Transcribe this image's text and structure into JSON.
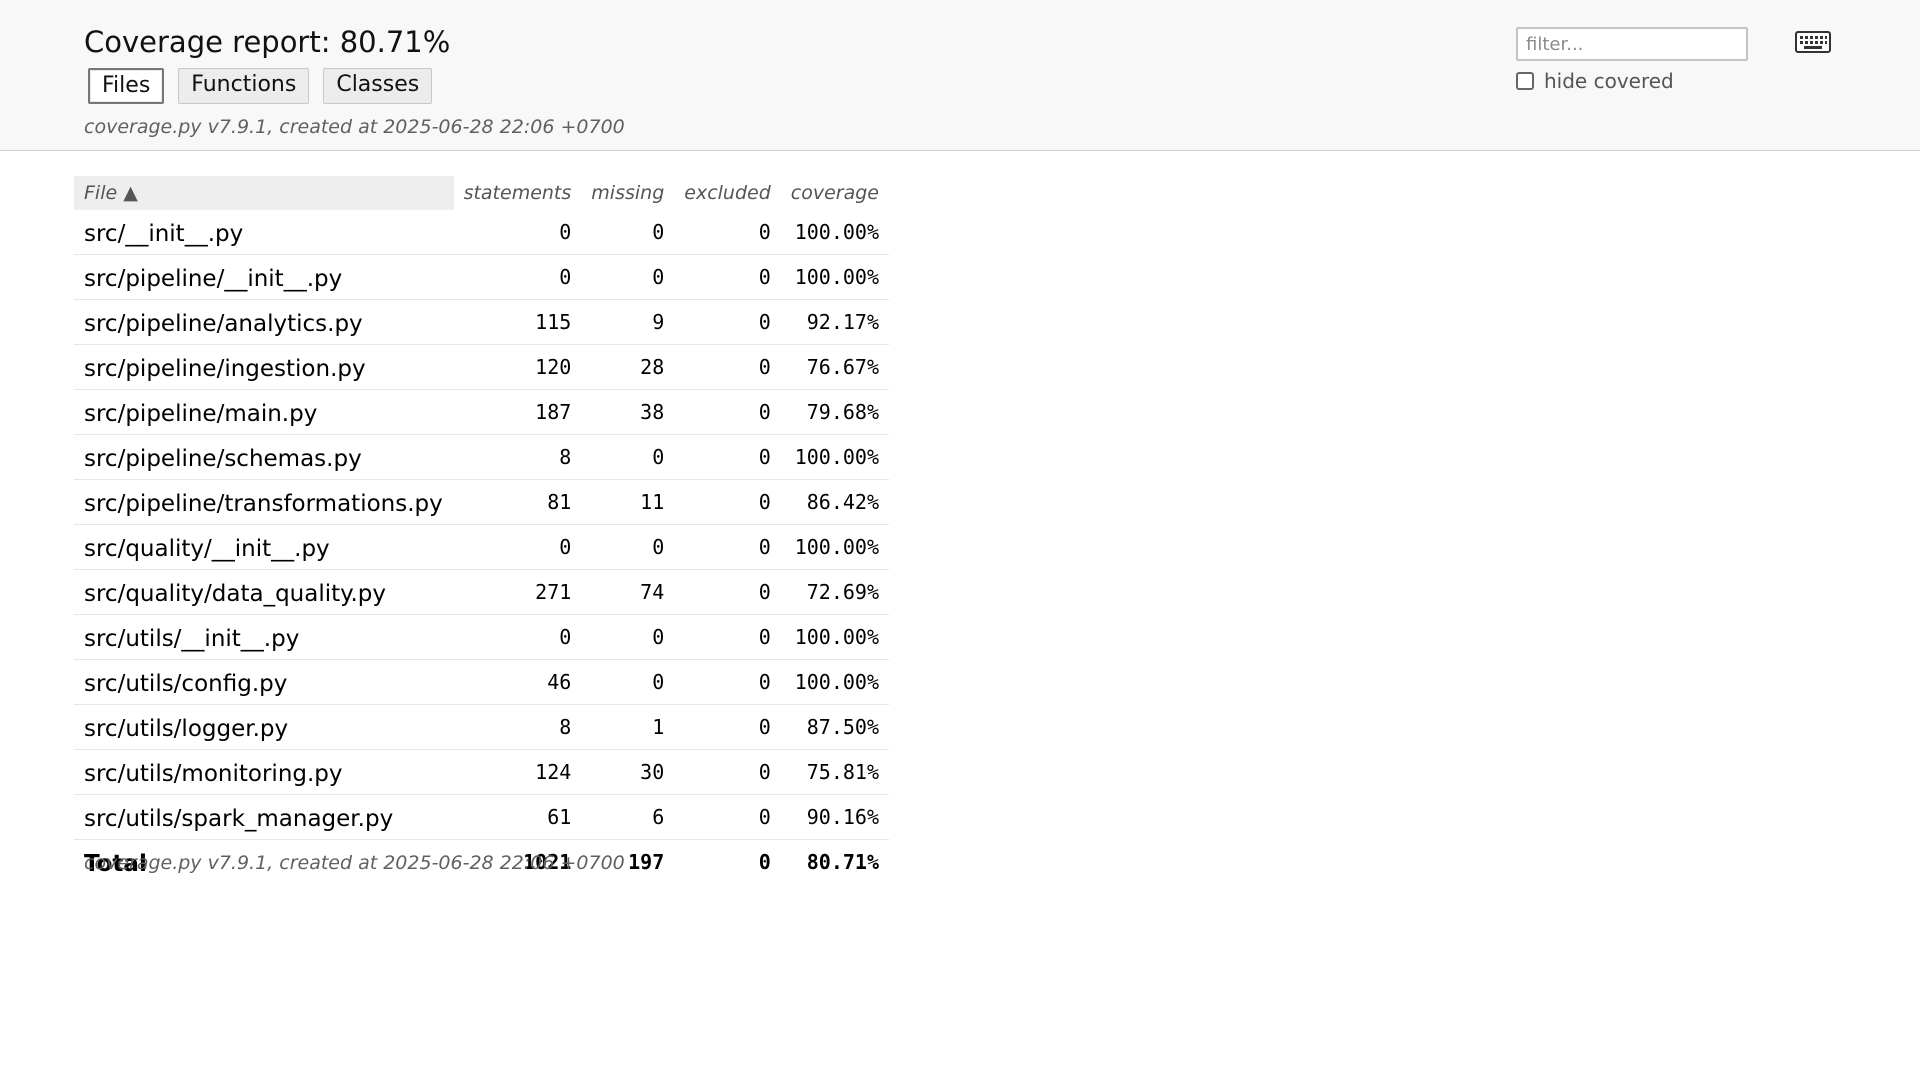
{
  "header": {
    "title": "Coverage report: 80.71%",
    "tabs": [
      {
        "label": "Files",
        "current": true
      },
      {
        "label": "Functions",
        "current": false
      },
      {
        "label": "Classes",
        "current": false
      }
    ],
    "meta": "coverage.py v7.9.1, created at 2025-06-28 22:06 +0700",
    "filter_placeholder": "filter...",
    "hide_covered_label": "hide covered",
    "hide_covered_checked": false,
    "keyboard_icon": "keyboard-icon"
  },
  "table": {
    "columns": [
      "File ▲",
      "statements",
      "missing",
      "excluded",
      "coverage"
    ],
    "rows": [
      {
        "file": "src/__init__.py",
        "statements": "0",
        "missing": "0",
        "excluded": "0",
        "coverage": "100.00%"
      },
      {
        "file": "src/pipeline/__init__.py",
        "statements": "0",
        "missing": "0",
        "excluded": "0",
        "coverage": "100.00%"
      },
      {
        "file": "src/pipeline/analytics.py",
        "statements": "115",
        "missing": "9",
        "excluded": "0",
        "coverage": "92.17%"
      },
      {
        "file": "src/pipeline/ingestion.py",
        "statements": "120",
        "missing": "28",
        "excluded": "0",
        "coverage": "76.67%"
      },
      {
        "file": "src/pipeline/main.py",
        "statements": "187",
        "missing": "38",
        "excluded": "0",
        "coverage": "79.68%"
      },
      {
        "file": "src/pipeline/schemas.py",
        "statements": "8",
        "missing": "0",
        "excluded": "0",
        "coverage": "100.00%"
      },
      {
        "file": "src/pipeline/transformations.py",
        "statements": "81",
        "missing": "11",
        "excluded": "0",
        "coverage": "86.42%"
      },
      {
        "file": "src/quality/__init__.py",
        "statements": "0",
        "missing": "0",
        "excluded": "0",
        "coverage": "100.00%"
      },
      {
        "file": "src/quality/data_quality.py",
        "statements": "271",
        "missing": "74",
        "excluded": "0",
        "coverage": "72.69%"
      },
      {
        "file": "src/utils/__init__.py",
        "statements": "0",
        "missing": "0",
        "excluded": "0",
        "coverage": "100.00%"
      },
      {
        "file": "src/utils/config.py",
        "statements": "46",
        "missing": "0",
        "excluded": "0",
        "coverage": "100.00%"
      },
      {
        "file": "src/utils/logger.py",
        "statements": "8",
        "missing": "1",
        "excluded": "0",
        "coverage": "87.50%"
      },
      {
        "file": "src/utils/monitoring.py",
        "statements": "124",
        "missing": "30",
        "excluded": "0",
        "coverage": "75.81%"
      },
      {
        "file": "src/utils/spark_manager.py",
        "statements": "61",
        "missing": "6",
        "excluded": "0",
        "coverage": "90.16%"
      }
    ],
    "total": {
      "file": "Total",
      "statements": "1021",
      "missing": "197",
      "excluded": "0",
      "coverage": "80.71%"
    }
  },
  "footer": {
    "meta": "coverage.py v7.9.1, created at 2025-06-28 22:06 +0700"
  }
}
